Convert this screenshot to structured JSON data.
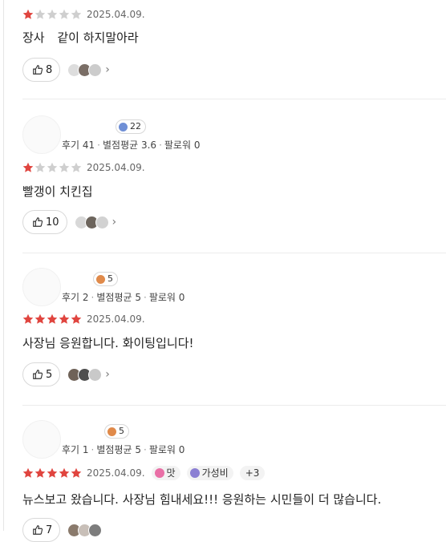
{
  "colors": {
    "star_filled": "#e0453f",
    "star_empty": "#cfcfcf"
  },
  "reviews": [
    {
      "rating": 1,
      "date": "2025.04.09.",
      "text": "장사 ⠀같이 하지말아라",
      "likes": "8"
    },
    {
      "badge": "22",
      "stats": {
        "reviews": "후기 41",
        "avg": "별점평균 3.6",
        "followers": "팔로워 0"
      },
      "rating": 1,
      "date": "2025.04.09.",
      "text": "빨갱이 치킨집",
      "likes": "10"
    },
    {
      "badge": "5",
      "stats": {
        "reviews": "후기 2",
        "avg": "별점평균 5",
        "followers": "팔로워 0"
      },
      "rating": 5,
      "date": "2025.04.09.",
      "text": "사장님 응원합니다. 화이팅입니다!",
      "likes": "5"
    },
    {
      "badge": "5",
      "stats": {
        "reviews": "후기 1",
        "avg": "별점평균 5",
        "followers": "팔로워 0"
      },
      "rating": 5,
      "date": "2025.04.09.",
      "tags": [
        "맛",
        "가성비"
      ],
      "tags_more": "+3",
      "text": "뉴스보고 왔습니다. 사장님 힘내세요!!! 응원하는 시민들이 더 많습니다.",
      "likes": "7"
    }
  ]
}
